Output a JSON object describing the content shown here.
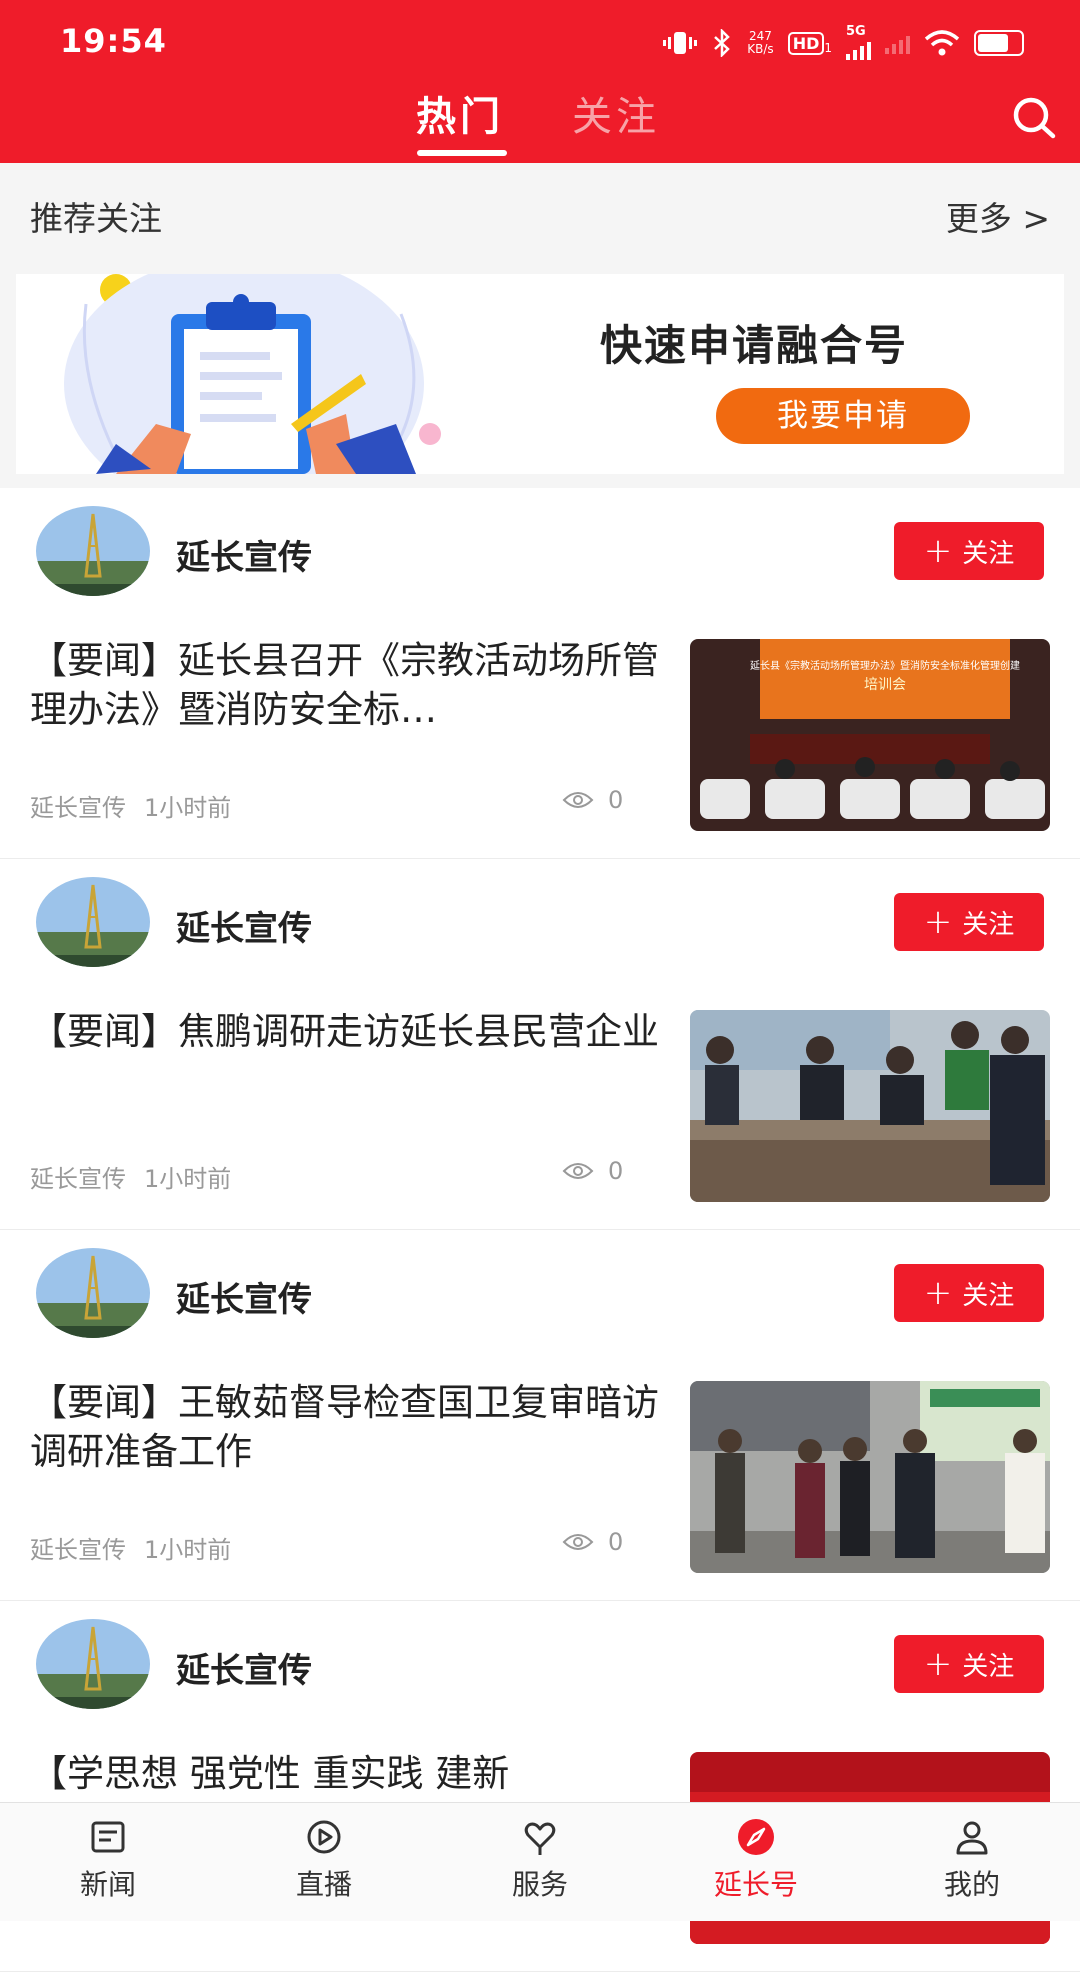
{
  "status_bar": {
    "time": "19:54",
    "net_speed_value": "247",
    "net_speed_unit": "KB/s",
    "hd_label": "HD",
    "hd_sub": "1",
    "network": "5G"
  },
  "header": {
    "tabs": [
      {
        "label": "热门",
        "active": true
      },
      {
        "label": "关注",
        "active": false
      }
    ],
    "search_icon": "search-icon"
  },
  "recommend": {
    "title": "推荐关注",
    "more": "更多 >"
  },
  "banner": {
    "title": "快速申请融合号",
    "button": "我要申请"
  },
  "feed": [
    {
      "author": "延长宣传",
      "follow": "关注",
      "title": "【要闻】延长县召开《宗教活动场所管理办法》暨消防安全标…",
      "source": "延长宣传",
      "time": "1小时前",
      "views": "0",
      "thumb_text": "延长县《宗教活动场所管理办法》暨消防安全标准化管理创建",
      "thumb_text2": "培训会"
    },
    {
      "author": "延长宣传",
      "follow": "关注",
      "title": "【要闻】焦鹏调研走访延长县民营企业",
      "source": "延长宣传",
      "time": "1小时前",
      "views": "0"
    },
    {
      "author": "延长宣传",
      "follow": "关注",
      "title": "【要闻】王敏茹督导检查国卫复审暗访调研准备工作",
      "source": "延长宣传",
      "time": "1小时前",
      "views": "0"
    },
    {
      "author": "延长宣传",
      "follow": "关注",
      "title": "【学思想 强党性 重实践 建新",
      "source": "",
      "time": "",
      "views": ""
    }
  ],
  "bottom_nav": [
    {
      "label": "新闻",
      "icon": "news-icon",
      "active": false
    },
    {
      "label": "直播",
      "icon": "live-play-icon",
      "active": false
    },
    {
      "label": "服务",
      "icon": "service-heart-icon",
      "active": false
    },
    {
      "label": "延长号",
      "icon": "compass-icon",
      "active": true
    },
    {
      "label": "我的",
      "icon": "profile-icon",
      "active": false
    }
  ],
  "colors": {
    "brand_red": "#ef1c2a",
    "apply_orange": "#f16a10",
    "muted_text": "#999999"
  }
}
